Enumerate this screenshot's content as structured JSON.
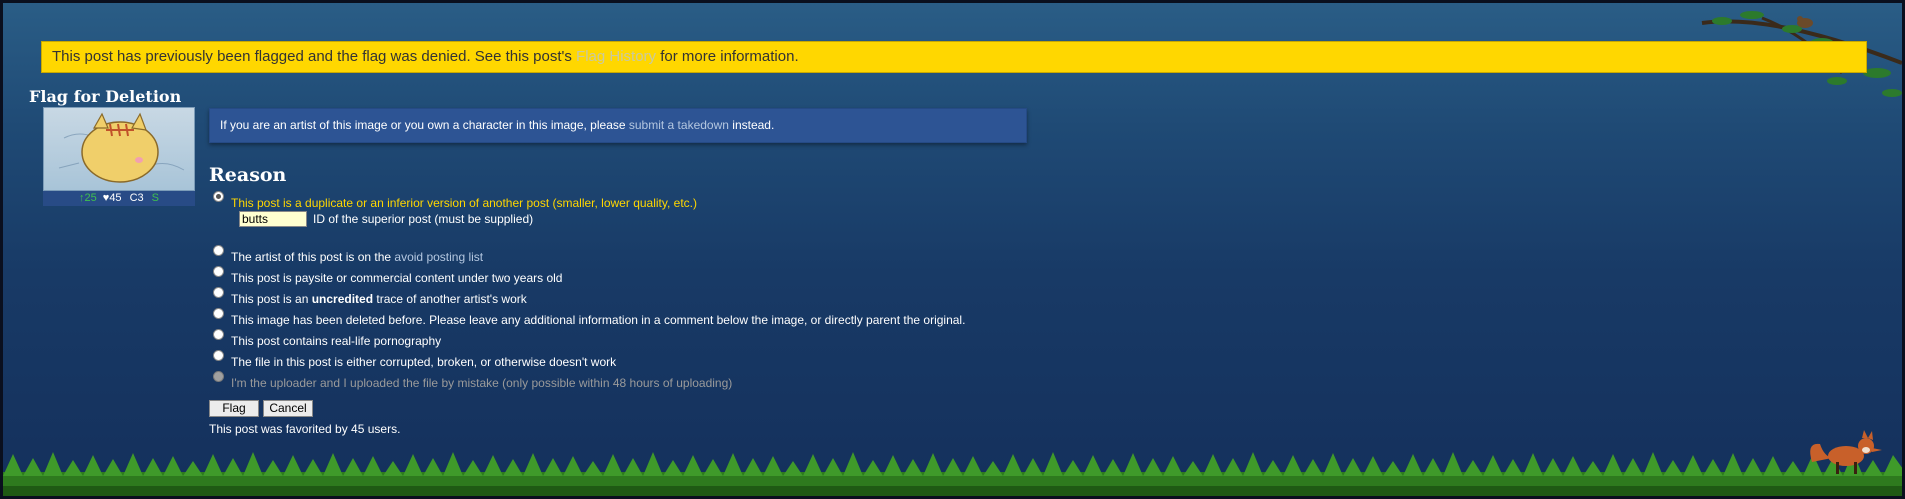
{
  "notice": {
    "before": "This post has previously been flagged and the flag was denied. See this post's ",
    "link": "Flag History",
    "after": " for more information."
  },
  "page_title": "Flag for Deletion",
  "thumbnail": {
    "score": "↑25",
    "favorites": "♥45",
    "comments": "C3",
    "rating": "S"
  },
  "info": {
    "before": "If you are an artist of this image or you own a character in this image, please ",
    "link": "submit a takedown",
    "after": " instead."
  },
  "reason_title": "Reason",
  "reasons": [
    {
      "label": "This post is a duplicate or an inferior version of another post (smaller, lower quality, etc.)"
    },
    {
      "before": "The artist of this post is on the ",
      "link": "avoid posting list"
    },
    {
      "label": "This post is paysite or commercial content under two years old"
    },
    {
      "before": "This post is an ",
      "bold": "uncredited",
      "after": " trace of another artist's work"
    },
    {
      "label": "This image has been deleted before. Please leave any additional information in a comment below the image, or directly parent the original."
    },
    {
      "label": "This post contains real-life pornography"
    },
    {
      "label": "The file in this post is either corrupted, broken, or otherwise doesn't work"
    },
    {
      "label": "I'm the uploader and I uploaded the file by mistake (only possible within 48 hours of uploading)"
    }
  ],
  "superior_post": {
    "value": "butts",
    "label": "ID of the superior post (must be supplied)"
  },
  "buttons": {
    "flag": "Flag",
    "cancel": "Cancel"
  },
  "favorited_text": "This post was favorited by 45 users.",
  "colors": {
    "notice_bg": "#ffd700",
    "selected_reason": "#ffd700",
    "link": "#b4c7e0"
  }
}
